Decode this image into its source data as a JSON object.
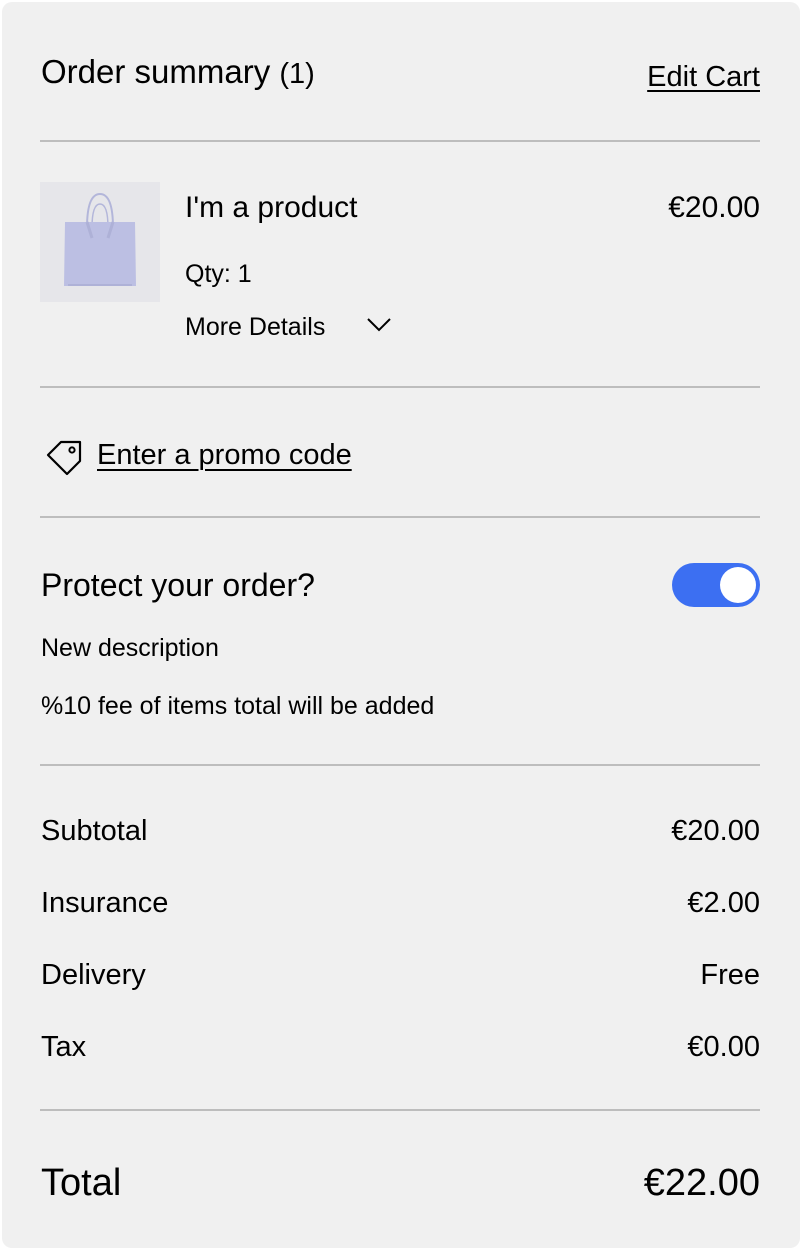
{
  "header": {
    "title": "Order summary",
    "count": "(1)",
    "edit_cart_label": "Edit Cart"
  },
  "product": {
    "name": "I'm a product",
    "price": "€20.00",
    "qty": "Qty: 1",
    "more_details_label": "More Details",
    "thumbnail_icon": "tote-bag-image",
    "thumbnail_color": "#bcbfe3"
  },
  "promo": {
    "icon": "tag-icon",
    "label": "Enter a promo code"
  },
  "protection": {
    "title": "Protect your order?",
    "enabled": true,
    "description": "New description",
    "fee_note": "%10 fee of items total will be added",
    "toggle_color": "#3c6ff2"
  },
  "totals": {
    "rows": [
      {
        "label": "Subtotal",
        "value": "€20.00"
      },
      {
        "label": "Insurance",
        "value": "€2.00"
      },
      {
        "label": "Delivery",
        "value": "Free"
      },
      {
        "label": "Tax",
        "value": "€0.00"
      }
    ],
    "total_label": "Total",
    "total_value": "€22.00"
  }
}
